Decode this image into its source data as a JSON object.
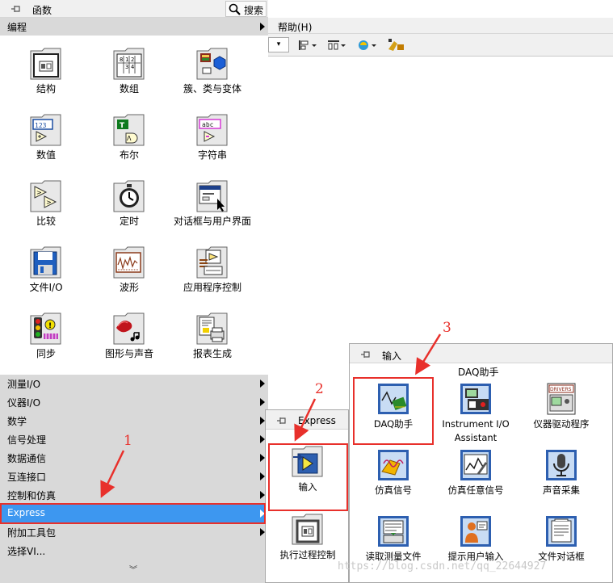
{
  "background_window": {
    "menu_help": "帮助(H)"
  },
  "palette": {
    "title": "函数",
    "search_label": "搜索",
    "top_category": "编程",
    "programming_items": [
      {
        "label": "结构",
        "icon": "structures-icon"
      },
      {
        "label": "数组",
        "icon": "array-icon"
      },
      {
        "label": "簇、类与变体",
        "icon": "cluster-class-variant-icon"
      },
      {
        "label": "数值",
        "icon": "numeric-icon"
      },
      {
        "label": "布尔",
        "icon": "boolean-icon"
      },
      {
        "label": "字符串",
        "icon": "string-icon"
      },
      {
        "label": "比较",
        "icon": "comparison-icon"
      },
      {
        "label": "定时",
        "icon": "timing-icon"
      },
      {
        "label": "对话框与用户界面",
        "icon": "dialog-ui-icon"
      },
      {
        "label": "文件I/O",
        "icon": "file-io-icon"
      },
      {
        "label": "波形",
        "icon": "waveform-icon"
      },
      {
        "label": "应用程序控制",
        "icon": "application-control-icon"
      },
      {
        "label": "同步",
        "icon": "synchronization-icon"
      },
      {
        "label": "图形与声音",
        "icon": "graphics-sound-icon"
      },
      {
        "label": "报表生成",
        "icon": "report-generation-icon"
      }
    ],
    "categories": [
      {
        "label": "测量I/O",
        "has_submenu": true,
        "selected": false
      },
      {
        "label": "仪器I/O",
        "has_submenu": true,
        "selected": false
      },
      {
        "label": "数学",
        "has_submenu": true,
        "selected": false
      },
      {
        "label": "信号处理",
        "has_submenu": true,
        "selected": false
      },
      {
        "label": "数据通信",
        "has_submenu": true,
        "selected": false
      },
      {
        "label": "互连接口",
        "has_submenu": true,
        "selected": false
      },
      {
        "label": "控制和仿真",
        "has_submenu": true,
        "selected": false
      },
      {
        "label": "Express",
        "has_submenu": true,
        "selected": true
      },
      {
        "label": "附加工具包",
        "has_submenu": true,
        "selected": false
      },
      {
        "label": "选择VI...",
        "has_submenu": false,
        "selected": false
      }
    ],
    "selected_color": "#3d97f0"
  },
  "express_palette": {
    "title": "Express",
    "items": [
      {
        "label": "输入",
        "icon": "express-input-icon"
      },
      {
        "label": "执行过程控制",
        "icon": "exec-control-icon"
      }
    ]
  },
  "input_palette": {
    "title": "输入",
    "daq_header": "DAQ助手",
    "items": [
      {
        "label": "DAQ助手",
        "icon": "daq-assistant-icon"
      },
      {
        "label": "Instrument I/O Assistant",
        "icon": "instrument-io-assistant-icon"
      },
      {
        "label": "仪器驱动程序",
        "icon": "instrument-drivers-icon"
      },
      {
        "label": "仿真信号",
        "icon": "simulate-signal-icon"
      },
      {
        "label": "仿真任意信号",
        "icon": "simulate-arbitrary-signal-icon"
      },
      {
        "label": "声音采集",
        "icon": "acquire-sound-icon"
      },
      {
        "label": "读取测量文件",
        "icon": "read-measurement-file-icon"
      },
      {
        "label": "提示用户输入",
        "icon": "prompt-user-icon"
      },
      {
        "label": "文件对话框",
        "icon": "file-dialog-icon"
      }
    ]
  },
  "annotations": {
    "labels": [
      "1",
      "2",
      "3"
    ],
    "color": "#e8302b"
  },
  "watermark": "https://blog.csdn.net/qq_22644927"
}
